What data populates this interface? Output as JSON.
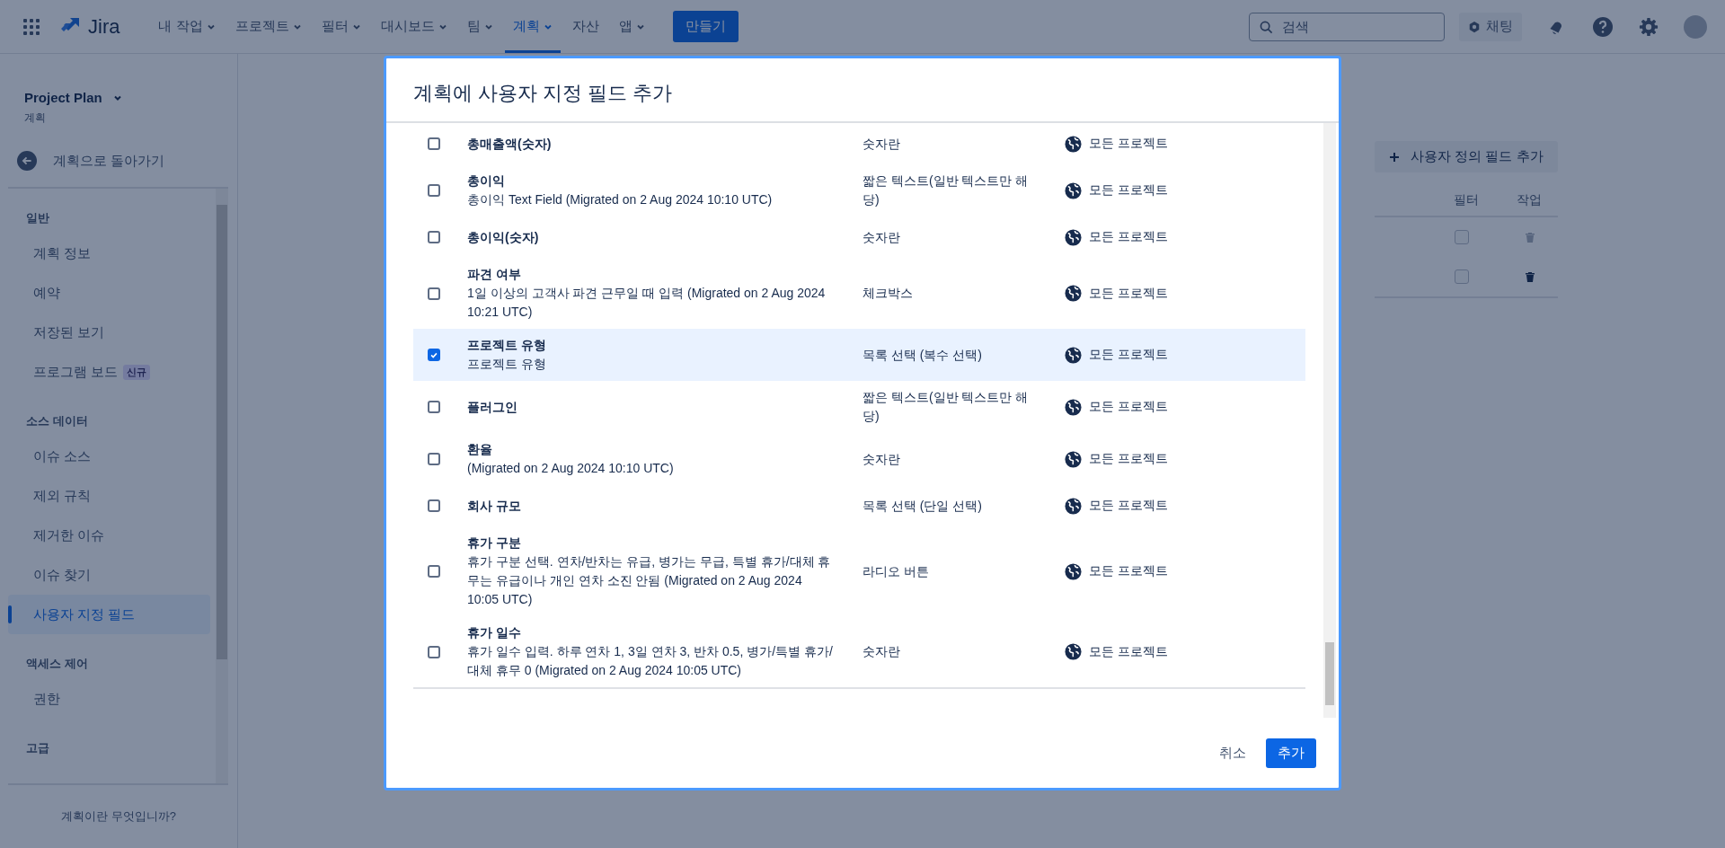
{
  "topnav": {
    "logo": "Jira",
    "items": [
      {
        "label": "내 작업",
        "dropdown": true,
        "selected": false
      },
      {
        "label": "프로젝트",
        "dropdown": true,
        "selected": false
      },
      {
        "label": "필터",
        "dropdown": true,
        "selected": false
      },
      {
        "label": "대시보드",
        "dropdown": true,
        "selected": false
      },
      {
        "label": "팀",
        "dropdown": true,
        "selected": false
      },
      {
        "label": "계획",
        "dropdown": true,
        "selected": true
      },
      {
        "label": "자산",
        "dropdown": false,
        "selected": false
      },
      {
        "label": "앱",
        "dropdown": true,
        "selected": false
      }
    ],
    "create_button": "만들기",
    "search": {
      "placeholder": "검색"
    },
    "chat_button": "채팅"
  },
  "sidebar": {
    "project_name": "Project Plan",
    "project_type": "계획",
    "back_link": "계획으로 돌아가기",
    "sections": [
      {
        "heading": "일반",
        "items": [
          {
            "label": "계획 정보",
            "selected": false
          },
          {
            "label": "예약",
            "selected": false
          },
          {
            "label": "저장된 보기",
            "selected": false
          },
          {
            "label": "프로그램 보드",
            "badge": "신규",
            "selected": false
          }
        ]
      },
      {
        "heading": "소스 데이터",
        "items": [
          {
            "label": "이슈 소스",
            "selected": false
          },
          {
            "label": "제외 규칙",
            "selected": false
          },
          {
            "label": "제거한 이슈",
            "selected": false
          },
          {
            "label": "이슈 찾기",
            "selected": false
          },
          {
            "label": "사용자 지정 필드",
            "selected": true
          }
        ]
      },
      {
        "heading": "액세스 제어",
        "items": [
          {
            "label": "권한",
            "selected": false
          }
        ]
      },
      {
        "heading": "고급"
      }
    ],
    "footer_link": "계획이란 무엇입니까?"
  },
  "page": {
    "add_button": "사용자 정의 필드 추가",
    "columns": [
      "필터",
      "작업"
    ],
    "rows": [
      {
        "filter_checked": false,
        "delete_disabled": true
      },
      {
        "filter_checked": false,
        "delete_disabled": false
      }
    ]
  },
  "modal": {
    "title": "계획에 사용자 지정 필드 추가",
    "rows": [
      {
        "name": "총매출액(숫자)",
        "type": "숫자란",
        "scope": "모든 프로젝트",
        "checked": false
      },
      {
        "name": "총이익",
        "description": "총이익 Text Field (Migrated on 2 Aug 2024 10:10 UTC)",
        "type": "짧은 텍스트(일반 텍스트만 해당)",
        "scope": "모든 프로젝트",
        "checked": false
      },
      {
        "name": "총이익(숫자)",
        "type": "숫자란",
        "scope": "모든 프로젝트",
        "checked": false
      },
      {
        "name": "파견 여부",
        "description": "1일 이상의 고객사 파견 근무일 때 입력 (Migrated on 2 Aug 2024 10:21 UTC)",
        "type": "체크박스",
        "scope": "모든 프로젝트",
        "checked": false
      },
      {
        "name": "프로젝트 유형",
        "description": "프로젝트 유형",
        "type": "목록 선택 (복수 선택)",
        "scope": "모든 프로젝트",
        "checked": true
      },
      {
        "name": "플러그인",
        "type": "짧은 텍스트(일반 텍스트만 해당)",
        "scope": "모든 프로젝트",
        "checked": false
      },
      {
        "name": "환율",
        "description": "(Migrated on 2 Aug 2024 10:10 UTC)",
        "type": "숫자란",
        "scope": "모든 프로젝트",
        "checked": false
      },
      {
        "name": "회사 규모",
        "type": "목록 선택 (단일 선택)",
        "scope": "모든 프로젝트",
        "checked": false
      },
      {
        "name": "휴가 구분",
        "description": "휴가 구분 선택. 연차/반차는 유급, 병가는 무급, 특별 휴가/대체 휴무는 유급이나 개인 연차 소진 안됨 (Migrated on 2 Aug 2024 10:05 UTC)",
        "type": "라디오 버튼",
        "scope": "모든 프로젝트",
        "checked": false
      },
      {
        "name": "휴가 일수",
        "description": "휴가 일수 입력. 하루 연차 1, 3일 연차 3, 반차 0.5, 병가/특별 휴가/대체 휴무 0 (Migrated on 2 Aug 2024 10:05 UTC)",
        "type": "숫자란",
        "scope": "모든 프로젝트",
        "checked": false
      }
    ],
    "cancel_button": "취소",
    "add_button": "추가"
  }
}
